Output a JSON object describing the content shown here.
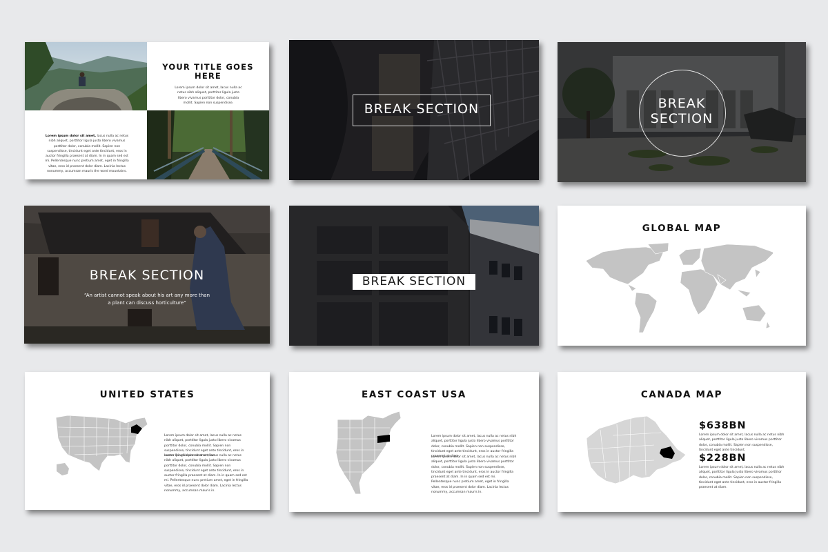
{
  "slide1": {
    "title": "YOUR TITLE GOES HERE",
    "body_top": "Lorem ipsum dolor sit amet, lacus nulla ac netus nibh aliquet, porttitor ligula justo libero vivamus porttitor dolor, conubia mollit. Sapien non suspendisse.",
    "body_bottom_lead": "Lorem ipsum dolor sit amet,",
    "body_bottom": " lacus nulla ac netus nibh aliquet, porttitor ligula justo libero vivamus porttitor dolor, conubia mollit. Sapien non suspendisse, tincidunt eget ante tincidunt, eros in auctor fringilla praesent at diam. In in quam sed est mi. Pellentesque nunc pretium amet, eget in fringilla vitae, eros id praesent dolor diam. Lacinia lectus nonummy, accumsan mauris the word mountains."
  },
  "slide2": {
    "title": "BREAK SECTION"
  },
  "slide3": {
    "title": "BREAK SECTION"
  },
  "slide4": {
    "title": "BREAK SECTION",
    "quote": "“An artist cannot speak about his art any more than a plant can discuss horticulture”"
  },
  "slide5": {
    "title": "BREAK SECTION"
  },
  "slide6": {
    "title": "GLOBAL MAP"
  },
  "slide7": {
    "title": "UNITED STATES",
    "para1": "Lorem ipsum dolor sit amet, lacus nulla ac netus nibh aliquet, porttitor ligula justo libero vivamus porttitor dolor, conubia mollit. Sapien non suspendisse, tincidunt eget ante tincidunt, eros in auctor fringilla praesent at diam.",
    "para2": "Lorem ipsum dolor sit amet, lacus nulla ac netus nibh aliquet, porttitor ligula justo libero vivamus porttitor dolor, conubia mollit. Sapien non suspendisse, tincidunt eget ante tincidunt, eros in auctor fringilla praesent at diam. In in quam sed est mi. Pellentesque nunc pretium amet, eget in fringilla vitae, eros id praesent dolor diam. Lacinia lectus nonummy, accumsan mauris in."
  },
  "slide8": {
    "title": "EAST COAST USA",
    "para1": "Lorem ipsum dolor sit amet, lacus nulla ac netus nibh aliquet, porttitor ligula justo libero vivamus porttitor dolor, conubia mollit. Sapien non suspendisse, tincidunt eget ante tincidunt, eros in auctor fringilla praesent at diam.",
    "para2": "Lorem ipsum dolor sit amet, lacus nulla ac netus nibh aliquet, porttitor ligula justo libero vivamus porttitor dolor, conubia mollit. Sapien non suspendisse, tincidunt eget ante tincidunt, eros in auctor fringilla praesent at diam. In in quam sed est mi. Pellentesque nunc pretium amet, eget in fringilla vitae, eros id praesent dolor diam. Lacinia lectus nonummy, accumsan mauris in."
  },
  "slide9": {
    "title": "CANADA MAP",
    "stat1": "$638BN",
    "stat1_text": "Lorem ipsum dolor sit amet, lacus nulla ac netus nibh aliquet, porttitor ligula justo libero vivamus porttitor dolor, conubia mollit. Sapien non suspendisse, tincidunt eget ante tincidunt.",
    "stat2": "$228BN",
    "stat2_text": "Lorem ipsum dolor sit amet, lacus nulla ac netus nibh aliquet, porttitor ligula justo libero vivamus porttitor dolor, conubia mollit. Sapien non suspendisse, tincidunt eget ante tincidunt, eros in auctor fringilla praesent at diam."
  },
  "colors": {
    "background": "#e8e9eb",
    "map_gray": "#c4c4c4",
    "highlight": "#000000"
  }
}
